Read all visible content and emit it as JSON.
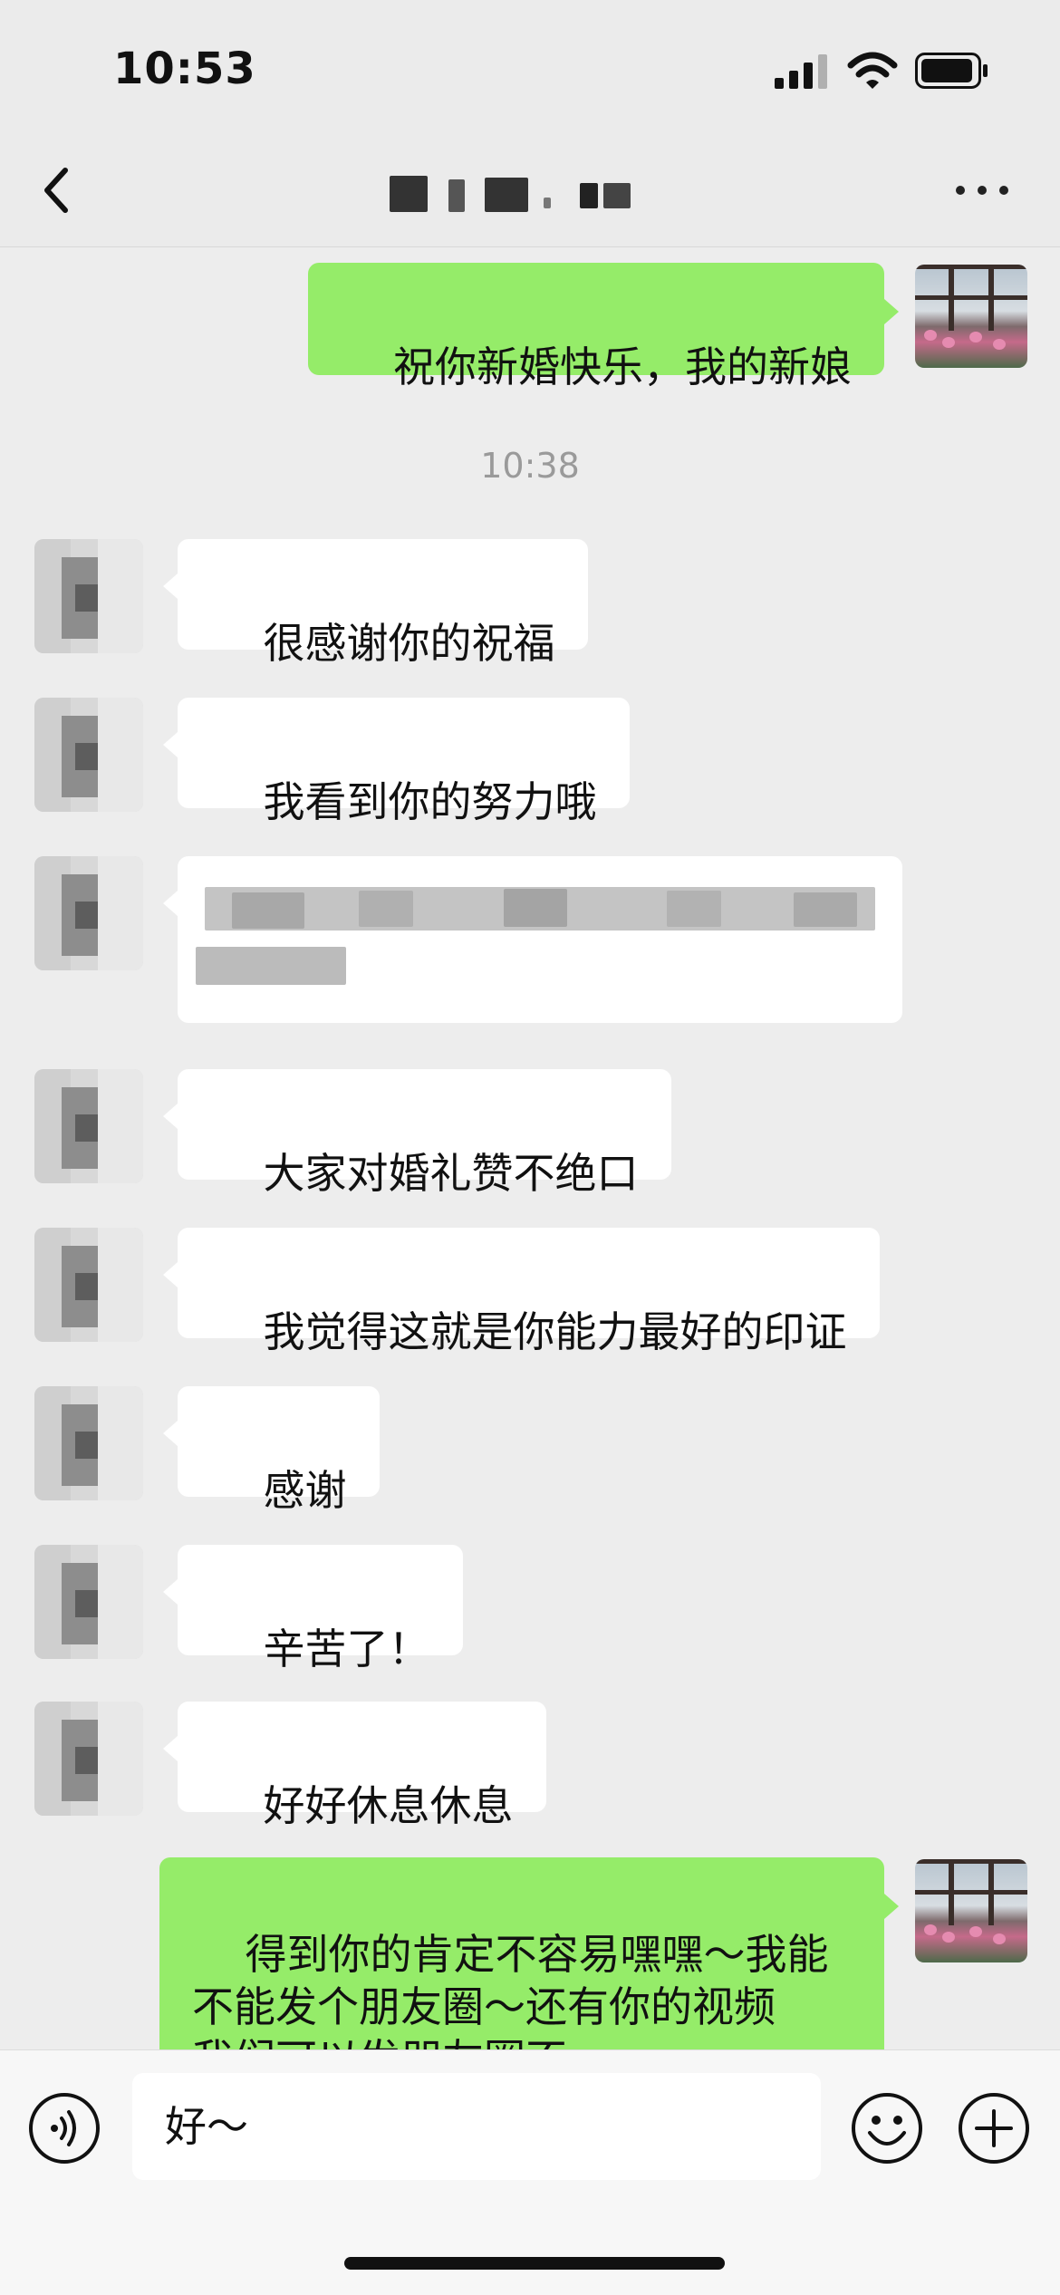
{
  "status_bar": {
    "time": "10:53"
  },
  "header": {
    "title": "",
    "back_icon": "chevron-left-icon",
    "more_icon": "more-dots-icon"
  },
  "messages": [
    {
      "side": "right",
      "text": "祝你新婚快乐，我的新娘"
    },
    {
      "side": "left",
      "text": "很感谢你的祝福"
    },
    {
      "side": "left",
      "text": "我看到你的努力哦"
    },
    {
      "side": "left",
      "text": ""
    },
    {
      "side": "left",
      "text": "大家对婚礼赞不绝口"
    },
    {
      "side": "left",
      "text": "我觉得这就是你能力最好的印证"
    },
    {
      "side": "left",
      "text": "感谢"
    },
    {
      "side": "left",
      "text": "辛苦了！"
    },
    {
      "side": "left",
      "text": "好好休息休息"
    },
    {
      "side": "right",
      "text": "得到你的肯定不容易嘿嘿～我能\n不能发个朋友圈～还有你的视频\n我们可以发朋友圈不～"
    }
  ],
  "time_divider": "10:38",
  "input_bar": {
    "value": "好～"
  },
  "colors": {
    "sent_bubble": "#95ec69",
    "received_bubble": "#ffffff",
    "background": "#ededed"
  }
}
